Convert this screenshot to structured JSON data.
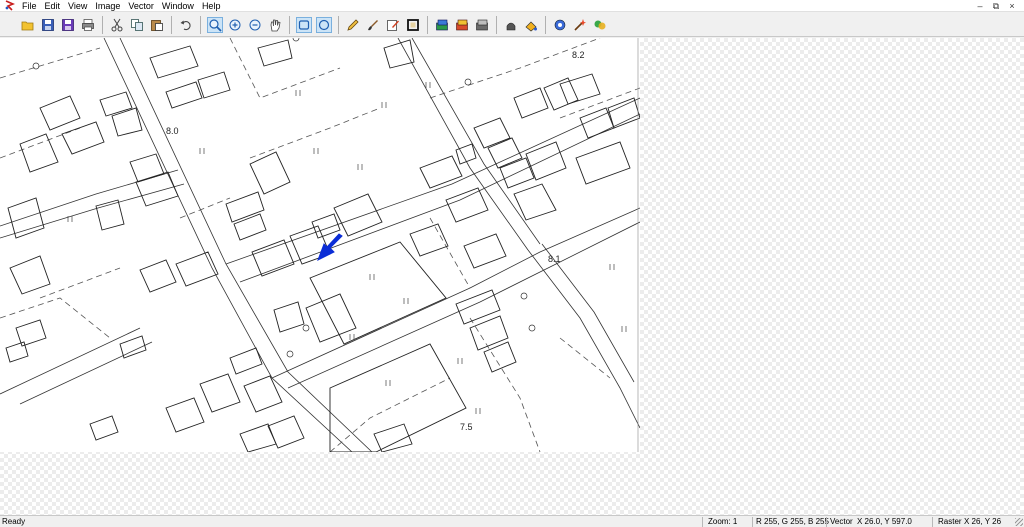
{
  "menu": {
    "items": [
      "File",
      "Edit",
      "View",
      "Image",
      "Vector",
      "Window",
      "Help"
    ]
  },
  "window_controls": {
    "minimize": "–",
    "restore": "⧉",
    "close": "×"
  },
  "toolbar": {
    "groups": [
      [
        "open-folder-icon",
        "save-icon",
        "save-as-icon",
        "print-icon"
      ],
      [
        "cut-icon",
        "copy-icon",
        "paste-icon"
      ],
      [
        "undo-icon"
      ],
      [
        "zoom-select-icon",
        "zoom-in-icon",
        "zoom-out-icon",
        "pan-hand-icon"
      ],
      [
        "select-rectangle-icon",
        "select-circle-icon"
      ],
      [
        "pencil-icon",
        "brush-icon",
        "edit-sheet-icon",
        "crop-frame-icon"
      ],
      [
        "layer-raster-icon",
        "layer-vector-icon",
        "layer-grid-icon"
      ],
      [
        "stamp-icon",
        "fill-bucket-icon"
      ],
      [
        "settings-gear-icon",
        "wizard-icon",
        "plugin-icon"
      ]
    ],
    "active": [
      "zoom-select-icon",
      "select-rectangle-icon",
      "select-circle-icon"
    ]
  },
  "map": {
    "elevation_labels": [
      "8.2",
      "8.0",
      "8.1",
      "7.5"
    ],
    "arrow_color": "#0b2dd6"
  },
  "status": {
    "ready": "Ready",
    "zoom": "Zoom: 1",
    "color": "R 255, G 255, B 255",
    "vector_label": "Vector",
    "vector_coords": "X 26.0, Y 597.0",
    "raster_label": "Raster",
    "raster_coords": "X 26, Y 26"
  }
}
